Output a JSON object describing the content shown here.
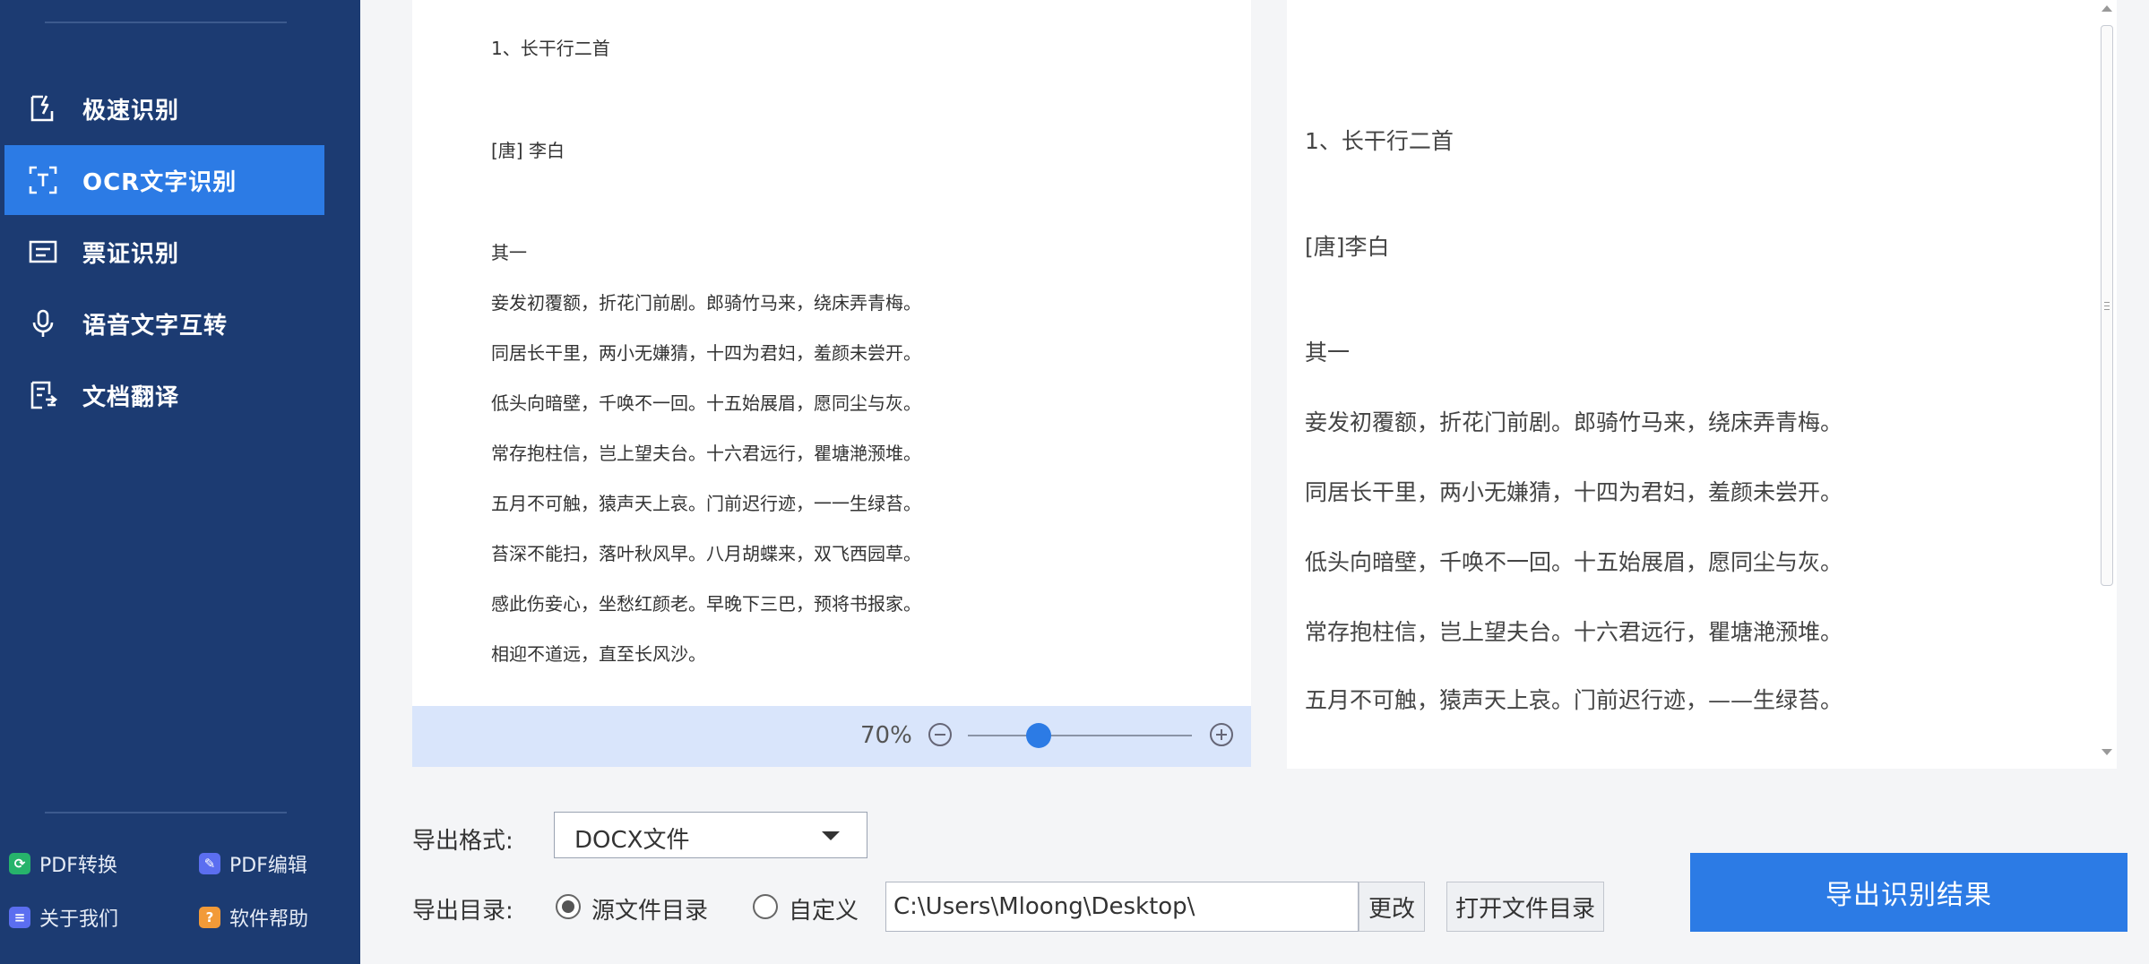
{
  "sidebar": {
    "nav": [
      {
        "label": "极速识别",
        "icon": "lightning-doc-icon",
        "active": false
      },
      {
        "label": "OCR文字识别",
        "icon": "text-scan-icon",
        "active": true
      },
      {
        "label": "票证识别",
        "icon": "id-card-icon",
        "active": false
      },
      {
        "label": "语音文字互转",
        "icon": "microphone-icon",
        "active": false
      },
      {
        "label": "文档翻译",
        "icon": "doc-translate-icon",
        "active": false
      }
    ],
    "links": [
      {
        "label": "PDF转换",
        "icon": "pdf-convert-icon",
        "color": "#27b36b"
      },
      {
        "label": "PDF编辑",
        "icon": "pdf-edit-icon",
        "color": "#5b6ef0"
      },
      {
        "label": "关于我们",
        "icon": "about-icon",
        "color": "#5b6ef0"
      },
      {
        "label": "软件帮助",
        "icon": "help-icon",
        "color": "#f29a38"
      }
    ]
  },
  "preview": {
    "lines": [
      "1、长干行二首",
      "[唐] 李白",
      "其一",
      "妾发初覆额，折花门前剧。郎骑竹马来，绕床弄青梅。",
      "同居长干里，两小无嫌猜，十四为君妇，羞颜未尝开。",
      "低头向暗壁，千唤不一回。十五始展眉，愿同尘与灰。",
      "常存抱柱信，岂上望夫台。十六君远行，瞿塘滟滪堆。",
      "五月不可触，猿声天上哀。门前迟行迹，一一生绿苔。",
      "苔深不能扫，落叶秋风早。八月胡蝶来，双飞西园草。",
      "感此伤妾心，坐愁红颜老。早晚下三巴，预将书报家。",
      "相迎不道远，直至长风沙。"
    ],
    "zoom": {
      "label": "70%",
      "value_percent": 70
    }
  },
  "result": {
    "lines": [
      "1、长干行二首",
      "[唐]李白",
      "其一",
      "妾发初覆额，折花门前剧。郎骑竹马来，绕床弄青梅。",
      "同居长干里，两小无嫌猜，十四为君妇，羞颜未尝开。",
      "低头向暗壁，千唤不一回。十五始展眉，愿同尘与灰。",
      "常存抱柱信，岂上望夫台。十六君远行，瞿塘滟滪堆。",
      "五月不可触，猿声天上哀。门前迟行迹，——生绿苔。"
    ]
  },
  "export": {
    "format_label": "导出格式:",
    "format_value": "DOCX文件",
    "dir_label": "导出目录:",
    "radio_source": "源文件目录",
    "radio_custom": "自定义",
    "path": "C:\\Users\\Mloong\\Desktop\\",
    "change_button": "更改",
    "open_dir_button": "打开文件目录",
    "export_button": "导出识别结果"
  },
  "colors": {
    "sidebar": "#1c3b72",
    "accent": "#2c7be5",
    "zoombar": "#d9e5fb"
  }
}
